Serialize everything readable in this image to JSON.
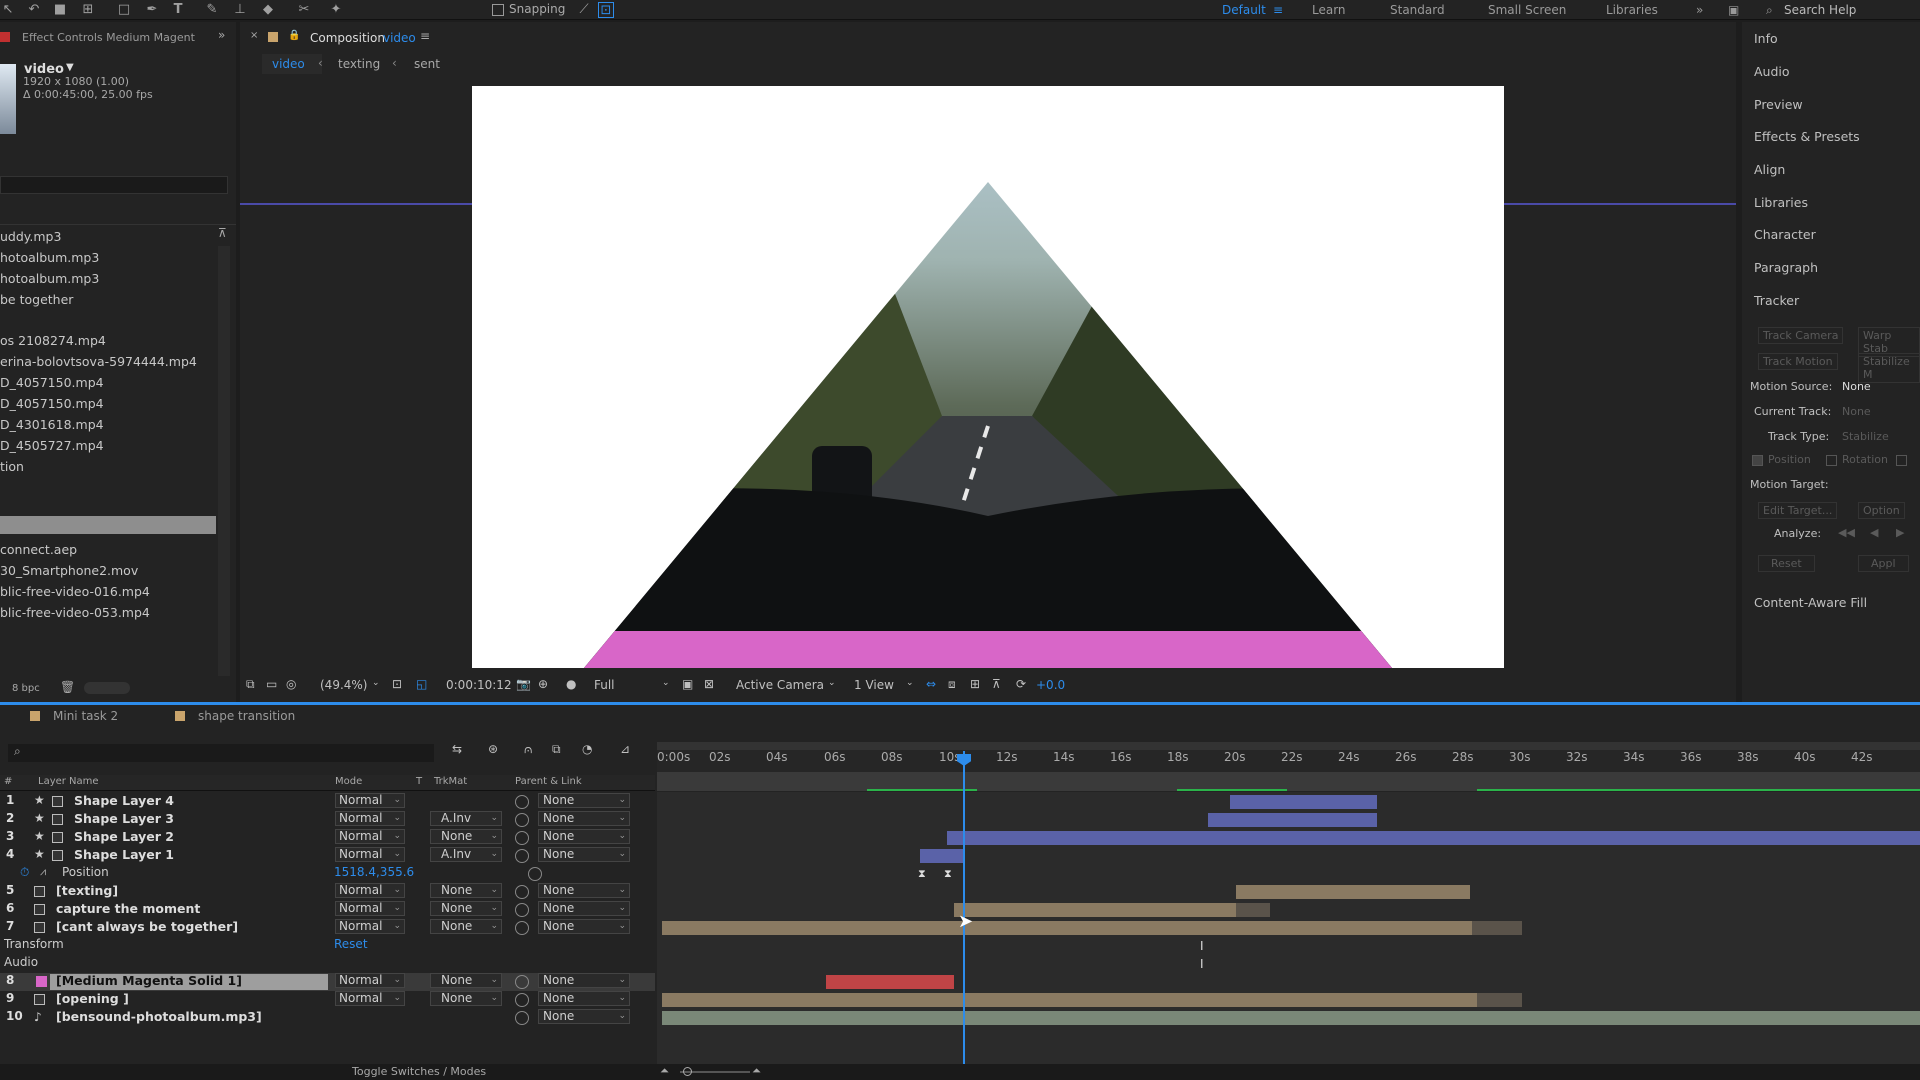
{
  "toolbar": {
    "snapping_label": "Snapping",
    "workspaces": [
      "Default",
      "Learn",
      "Standard",
      "Small Screen",
      "Libraries"
    ],
    "search_placeholder": "Search Help"
  },
  "effect_controls": {
    "tab_label": "Effect Controls Medium Magent",
    "comp_name": "video",
    "comp_res": "1920 x 1080 (1.00)",
    "comp_dur": "Δ 0:00:45:00, 25.00 fps"
  },
  "project": {
    "items": [
      "uddy.mp3",
      "hotoalbum.mp3",
      "hotoalbum.mp3",
      "be together",
      "os 2108274.mp4",
      "erina-bolovtsova-5974444.mp4",
      "D_4057150.mp4",
      "D_4057150.mp4",
      "D_4301618.mp4",
      "D_4505727.mp4",
      "tion",
      "connect.aep",
      "30_Smartphone2.mov",
      "blic-free-video-016.mp4",
      "blic-free-video-053.mp4"
    ],
    "bpc": "8 bpc"
  },
  "composition": {
    "panel_label": "Composition",
    "comp_link": "video",
    "breadcrumbs": [
      "video",
      "texting",
      "sent"
    ],
    "zoom": "(49.4%)",
    "timecode": "0:00:10:12",
    "resolution": "Full",
    "camera": "Active Camera",
    "views": "1 View",
    "exposure": "+0.0"
  },
  "right_panel": {
    "items": [
      "Info",
      "Audio",
      "Preview",
      "Effects & Presets",
      "Align",
      "Libraries",
      "Character",
      "Paragraph",
      "Tracker"
    ],
    "track_camera": "Track Camera",
    "warp_stab": "Warp Stab",
    "track_motion": "Track Motion",
    "stabilize": "Stabilize M",
    "motion_source_label": "Motion Source:",
    "motion_source_value": "None",
    "current_track_label": "Current Track:",
    "current_track_value": "None",
    "track_type_label": "Track Type:",
    "track_type_value": "Stabilize",
    "position": "Position",
    "rotation": "Rotation",
    "motion_target": "Motion Target:",
    "edit_target": "Edit Target...",
    "options": "Option",
    "analyze": "Analyze:",
    "reset": "Reset",
    "apply": "Appl",
    "content_aware": "Content-Aware Fill"
  },
  "timeline": {
    "tabs": [
      "Mini task 2",
      "shape transition"
    ],
    "headers": {
      "layer_name": "Layer Name",
      "mode": "Mode",
      "t": "T",
      "trkmat": "TrkMat",
      "parent": "Parent & Link"
    },
    "ruler": [
      "0:00s",
      "02s",
      "04s",
      "06s",
      "08s",
      "10s",
      "12s",
      "14s",
      "16s",
      "18s",
      "20s",
      "22s",
      "24s",
      "26s",
      "28s",
      "30s",
      "32s",
      "34s",
      "36s",
      "38s",
      "40s",
      "42s"
    ],
    "layers": [
      {
        "num": "1",
        "name": "Shape Layer 4",
        "mode": "Normal",
        "trkmat": "",
        "parent": "None"
      },
      {
        "num": "2",
        "name": "Shape Layer 3",
        "mode": "Normal",
        "trkmat": "A.Inv",
        "parent": "None"
      },
      {
        "num": "3",
        "name": "Shape Layer 2",
        "mode": "Normal",
        "trkmat": "None",
        "parent": "None"
      },
      {
        "num": "4",
        "name": "Shape Layer 1",
        "mode": "Normal",
        "trkmat": "A.Inv",
        "parent": "None"
      },
      {
        "num": "5",
        "name": "[texting]",
        "mode": "Normal",
        "trkmat": "None",
        "parent": "None"
      },
      {
        "num": "6",
        "name": "capture the moment",
        "mode": "Normal",
        "trkmat": "None",
        "parent": "None"
      },
      {
        "num": "7",
        "name": "[cant always be together]",
        "mode": "Normal",
        "trkmat": "None",
        "parent": "None"
      },
      {
        "num": "8",
        "name": "[Medium Magenta Solid 1]",
        "mode": "Normal",
        "trkmat": "None",
        "parent": "None"
      },
      {
        "num": "9",
        "name": "[opening ]",
        "mode": "Normal",
        "trkmat": "None",
        "parent": "None"
      },
      {
        "num": "10",
        "name": "[bensound-photoalbum.mp3]",
        "mode": "",
        "trkmat": "",
        "parent": "None"
      }
    ],
    "position_label": "Position",
    "position_value": "1518.4,355.6",
    "transform_label": "Transform",
    "reset_label": "Reset",
    "audio_label": "Audio",
    "toggle_label": "Toggle Switches / Modes"
  },
  "colors": {
    "accent": "#2d8ceb",
    "blue_bar": "#5a62a8",
    "tan_bar": "#8a7a62",
    "red_bar": "#c04446",
    "magenta": "#d866c8"
  }
}
